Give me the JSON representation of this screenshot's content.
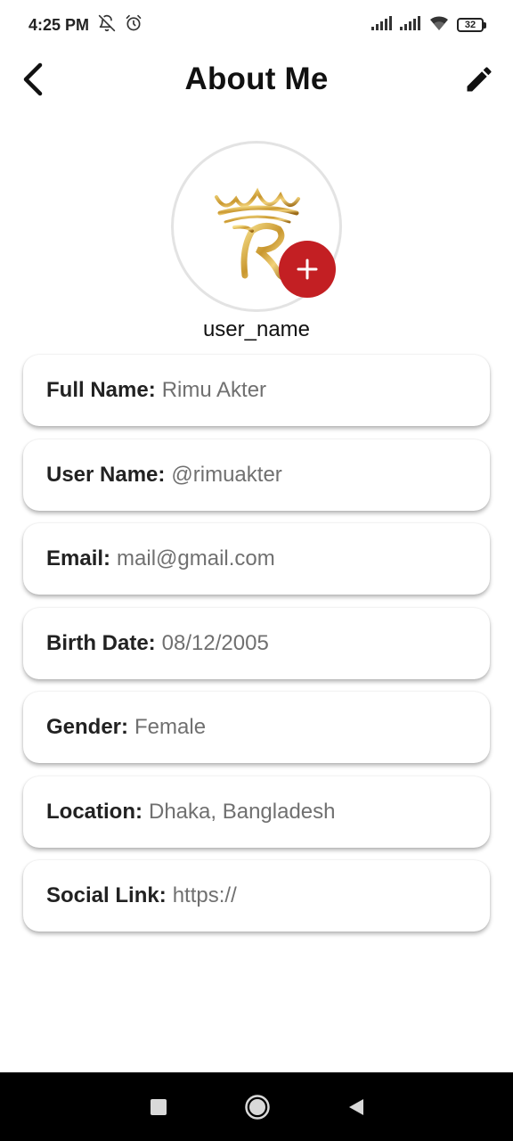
{
  "status_bar": {
    "time": "4:25 PM",
    "battery": "32",
    "icons": [
      "bell-off-icon",
      "alarm-icon",
      "signal-icon",
      "signal-icon",
      "wifi-icon",
      "battery-icon"
    ]
  },
  "app_bar": {
    "title": "About Me",
    "back_icon": "chevron-left-icon",
    "edit_icon": "pencil-icon"
  },
  "profile": {
    "username": "user_name",
    "avatar_logo": "crown-r-logo",
    "add_icon": "plus-icon",
    "accent": "#c31f23"
  },
  "fields": [
    {
      "label": "Full Name:",
      "value": "Rimu Akter"
    },
    {
      "label": "User Name:",
      "value": "@rimuakter"
    },
    {
      "label": "Email:",
      "value": "mail@gmail.com"
    },
    {
      "label": "Birth Date:",
      "value": "08/12/2005"
    },
    {
      "label": "Gender:",
      "value": "Female"
    },
    {
      "label": "Location:",
      "value": "Dhaka, Bangladesh"
    },
    {
      "label": "Social Link:",
      "value": "https://"
    }
  ],
  "nav_bar": {
    "icons": [
      "square-recents-icon",
      "circle-home-icon",
      "triangle-back-icon"
    ]
  }
}
